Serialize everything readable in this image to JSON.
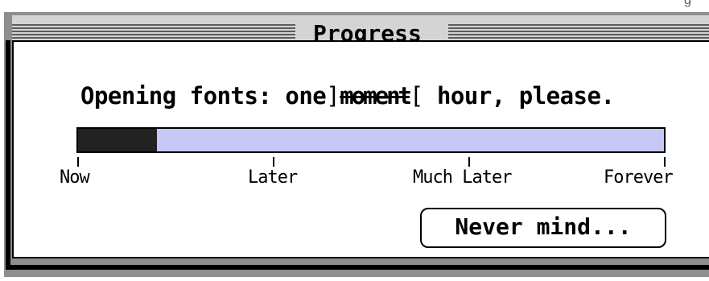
{
  "window": {
    "title": "Progress",
    "corner_fragment": "g"
  },
  "message": {
    "prefix": "Opening fonts: one",
    "struck_word": "moment",
    "suffix": "hour, please."
  },
  "progress": {
    "value_fraction": 0.135,
    "bar_color": "#c8c8f4",
    "fill_color": "#222222",
    "ticks": [
      "Now",
      "Later",
      "Much Later",
      "Forever"
    ]
  },
  "button": {
    "label": "Never mind..."
  }
}
